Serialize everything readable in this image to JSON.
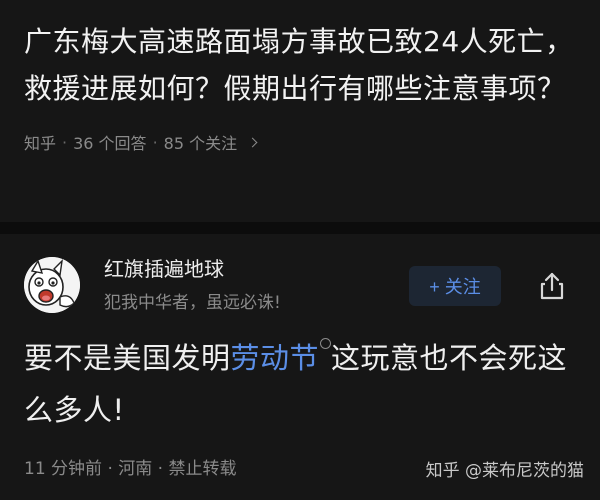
{
  "question": {
    "title": "广东梅大高速路面塌方事故已致24人死亡，救援进展如何？假期出行有哪些注意事项？",
    "source": "知乎",
    "answers": "36 个回答",
    "followers": "85 个关注"
  },
  "answer": {
    "author_name": "红旗插遍地球",
    "author_bio": "犯我中华者，虽远必诛!",
    "follow_label": "+ 关注",
    "text_before": "要不是美国发明",
    "text_link": "劳动节",
    "text_after": "这玩意也不会死这么多人!",
    "meta": "11 分钟前 · 河南 · 禁止转载"
  },
  "watermark": "知乎 @莱布尼茨的猫",
  "colors": {
    "background": "#161616",
    "accent": "#5b8ee6",
    "muted": "#8a8a8a"
  },
  "icons": {
    "share": "share-icon",
    "chevron": "chevron-right-icon",
    "search_mark": "search-hint-icon"
  }
}
